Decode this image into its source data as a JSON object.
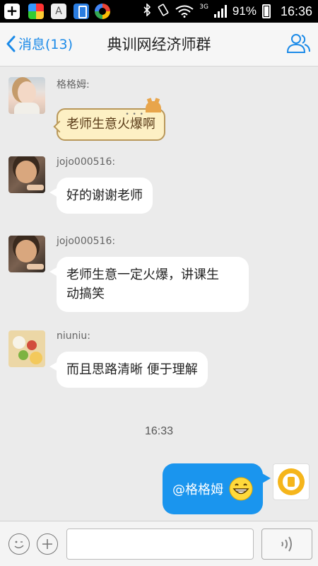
{
  "status_bar": {
    "battery": "91%",
    "time": "16:36",
    "network": "3G"
  },
  "header": {
    "back_label": "消息(13)",
    "title": "典训网经济师群"
  },
  "messages": [
    {
      "sender": "格格姆:",
      "text": "老师生意火爆啊",
      "style": "tag-bubble"
    },
    {
      "sender": "jojo000516:",
      "text": "好的谢谢老师"
    },
    {
      "sender": "jojo000516:",
      "text_line1": "老师生意一定火爆，讲课生",
      "text_line2": "动搞笑"
    },
    {
      "sender": "niuniu:",
      "text": "而且思路清晰 便于理解"
    }
  ],
  "timestamp": "16:33",
  "own_message": {
    "text": "@格格姆",
    "emoji": "grinning-face-icon"
  },
  "input": {
    "placeholder": ""
  },
  "colors": {
    "accent": "#1b8ae8",
    "own_bubble": "#1a95ee",
    "background": "#ebebeb"
  }
}
